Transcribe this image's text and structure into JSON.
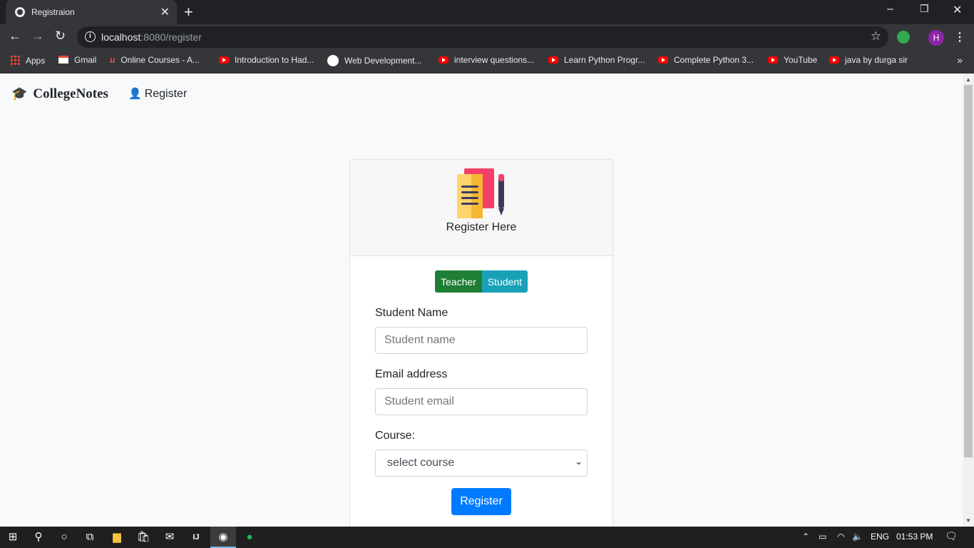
{
  "browser": {
    "tab_title": "Registraion",
    "url_host": "localhost",
    "url_path": ":8080/register",
    "avatar_initial": "H",
    "bookmarks": [
      "Apps",
      "Gmail",
      "Online Courses - A...",
      "Introduction to Had...",
      "Web Development...",
      "interview questions...",
      "Learn Python Progr...",
      "Complete Python 3...",
      "YouTube",
      "java by durga sir"
    ]
  },
  "navbar": {
    "brand": "CollegeNotes",
    "register_link": "Register"
  },
  "card": {
    "title": "Register Here",
    "toggle": {
      "teacher": "Teacher",
      "student": "Student"
    },
    "name_label": "Student Name",
    "name_placeholder": "Student name",
    "email_label": "Email address",
    "email_placeholder": "Student email",
    "course_label": "Course:",
    "course_selected": "select course",
    "submit": "Register"
  },
  "taskbar": {
    "language": "ENG",
    "time": "01:53 PM"
  },
  "colors": {
    "primary": "#007bff",
    "success": "#1e7e34",
    "info": "#17a2b8"
  }
}
